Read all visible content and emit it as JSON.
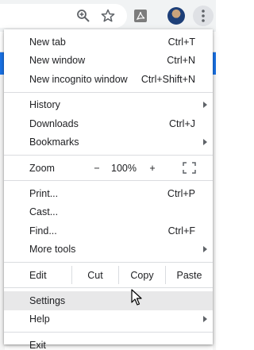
{
  "toolbar": {
    "zoom_icon": "magnifier-plus-icon",
    "star_icon": "star-icon",
    "extension_icon": "pdf-extension-icon",
    "avatar_icon": "profile-avatar",
    "menu_icon": "three-dot-menu-icon"
  },
  "menu": {
    "group1": [
      {
        "label": "New tab",
        "shortcut": "Ctrl+T"
      },
      {
        "label": "New window",
        "shortcut": "Ctrl+N"
      },
      {
        "label": "New incognito window",
        "shortcut": "Ctrl+Shift+N"
      }
    ],
    "group2": [
      {
        "label": "History",
        "shortcut": ""
      },
      {
        "label": "Downloads",
        "shortcut": "Ctrl+J"
      },
      {
        "label": "Bookmarks",
        "shortcut": ""
      }
    ],
    "zoom": {
      "label": "Zoom",
      "minus": "−",
      "value": "100%",
      "plus": "+",
      "fullscreen_icon": "fullscreen-icon"
    },
    "group3": [
      {
        "label": "Print...",
        "shortcut": "Ctrl+P"
      },
      {
        "label": "Cast...",
        "shortcut": ""
      },
      {
        "label": "Find...",
        "shortcut": "Ctrl+F"
      },
      {
        "label": "More tools",
        "shortcut": ""
      }
    ],
    "edit": {
      "label": "Edit",
      "cut": "Cut",
      "copy": "Copy",
      "paste": "Paste"
    },
    "group4": [
      {
        "label": "Settings",
        "shortcut": ""
      },
      {
        "label": "Help",
        "shortcut": ""
      }
    ],
    "group5": [
      {
        "label": "Exit",
        "shortcut": ""
      }
    ]
  },
  "colors": {
    "menu_background": "#ffffff",
    "hover_background": "#e8e8e9",
    "separator": "#dadce0",
    "text": "#202124",
    "toolbar": "#f1f3f4"
  }
}
